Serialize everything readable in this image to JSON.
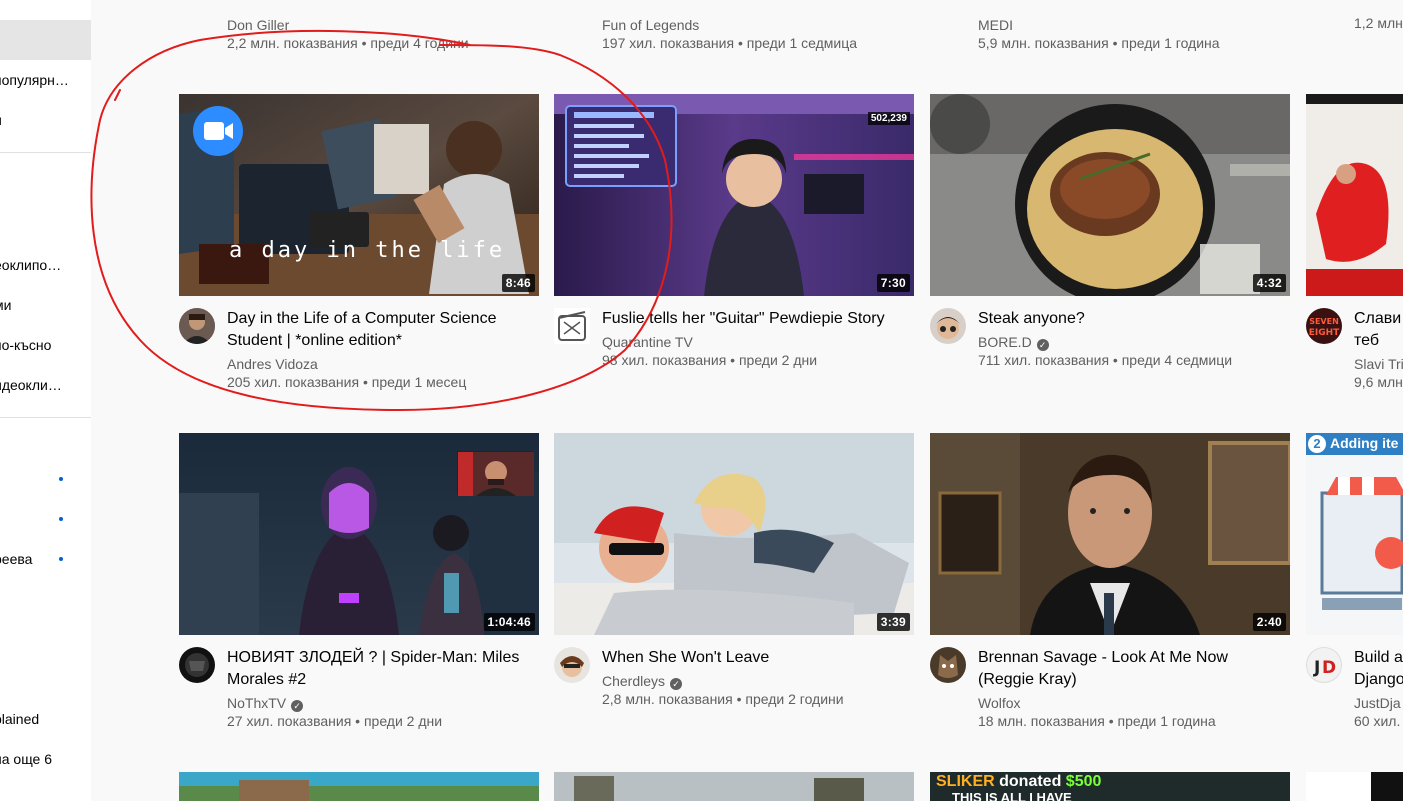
{
  "sidebar": {
    "items": [
      {
        "label": "популярн…"
      },
      {
        "label": "и"
      },
      {
        "label": "еоклипо…"
      },
      {
        "label": "ми"
      },
      {
        "label": "по-късно"
      },
      {
        "label": "идеокли…"
      },
      {
        "label": "реева"
      },
      {
        "label": "plained"
      },
      {
        "label": "на още 6"
      }
    ]
  },
  "feed": {
    "top_row": [
      {
        "channel": "Don Giller",
        "meta": "2,2 млн. показвания • преди 4 години"
      },
      {
        "channel": "Fun of Legends",
        "meta": "197 хил. показвания • преди 1 седмица"
      },
      {
        "channel": "MEDI",
        "meta": "5,9 млн. показвания • преди 1 година"
      },
      {
        "channel": "",
        "meta": "1,2 млн"
      }
    ],
    "row1": [
      {
        "title": "Day in the Life of a Computer Science Student | *online edition*",
        "channel": "Andres Vidoza",
        "meta": "205 хил. показвания • преди 1 месец",
        "duration": "8:46",
        "overlay_text": "a day in the life"
      },
      {
        "title": "Fuslie tells her \"Guitar\" Pewdiepie Story",
        "channel": "Quarantine TV",
        "meta": "98 хил. показвания • преди 2 дни",
        "duration": "7:30",
        "viewer_count": "502,239"
      },
      {
        "title": "Steak anyone?",
        "channel": "BORE.D",
        "meta": "711 хил. показвания • преди 4 седмици",
        "duration": "4:32"
      },
      {
        "title": "Слави теб",
        "channel": "Slavi Tri",
        "meta": "9,6 млн"
      }
    ],
    "row2": [
      {
        "title": "НОВИЯТ ЗЛОДЕЙ ? | Spider-Man: Miles Morales #2",
        "channel": "NoThxTV",
        "meta": "27 хил. показвания • преди 2 дни",
        "duration": "1:04:46"
      },
      {
        "title": "When She Won't Leave",
        "channel": "Cherdleys",
        "meta": "2,8 млн. показвания • преди 2 години",
        "duration": "3:39"
      },
      {
        "title": "Brennan Savage - Look At Me Now (Reggie Kray)",
        "channel": "Wolfox",
        "meta": "18 млн. показвания • преди 1 година",
        "duration": "2:40"
      },
      {
        "title": "Build a Django",
        "channel": "JustDja",
        "meta": "60 хил.",
        "overlay_text": "Adding ite",
        "overlay_number": "2"
      }
    ],
    "row3": [
      {
        "overlay_text": "SLIKER donated $500",
        "overlay_text2": "THIS IS ALL I HAVE"
      }
    ]
  },
  "colors": {
    "annotation_stroke": "#e21b1b",
    "verified_badge": "#606060",
    "meta_text": "#606060"
  },
  "icons": {
    "zoom_badge": "video-camera-icon",
    "verified": "check-icon"
  }
}
